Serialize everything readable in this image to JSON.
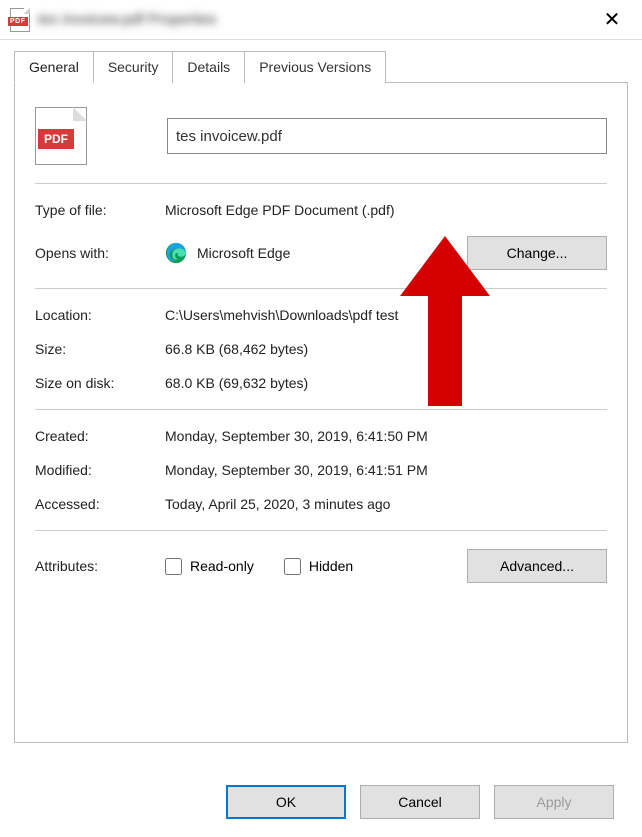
{
  "titlebar_text": "  tes invoicew.pdf Properties",
  "tabs": {
    "general": "General",
    "security": "Security",
    "details": "Details",
    "previous": "Previous Versions"
  },
  "filename": "tes invoicew.pdf",
  "labels": {
    "type": "Type of file:",
    "opens": "Opens with:",
    "location": "Location:",
    "size": "Size:",
    "disksize": "Size on disk:",
    "created": "Created:",
    "modified": "Modified:",
    "accessed": "Accessed:",
    "attributes": "Attributes:"
  },
  "values": {
    "type": "Microsoft Edge PDF Document (.pdf)",
    "opens": "Microsoft Edge",
    "location": "C:\\Users\\mehvish\\Downloads\\pdf test",
    "size": "66.8 KB (68,462 bytes)",
    "disksize": "68.0 KB (69,632 bytes)",
    "created": "Monday, September 30, 2019, 6:41:50 PM",
    "modified": "Monday, September 30, 2019, 6:41:51 PM",
    "accessed": "Today, April 25, 2020, 3 minutes ago"
  },
  "buttons": {
    "change": "Change...",
    "advanced": "Advanced...",
    "ok": "OK",
    "cancel": "Cancel",
    "apply": "Apply"
  },
  "checkboxes": {
    "readonly": "Read-only",
    "hidden": "Hidden"
  },
  "icon_badge": "PDF"
}
